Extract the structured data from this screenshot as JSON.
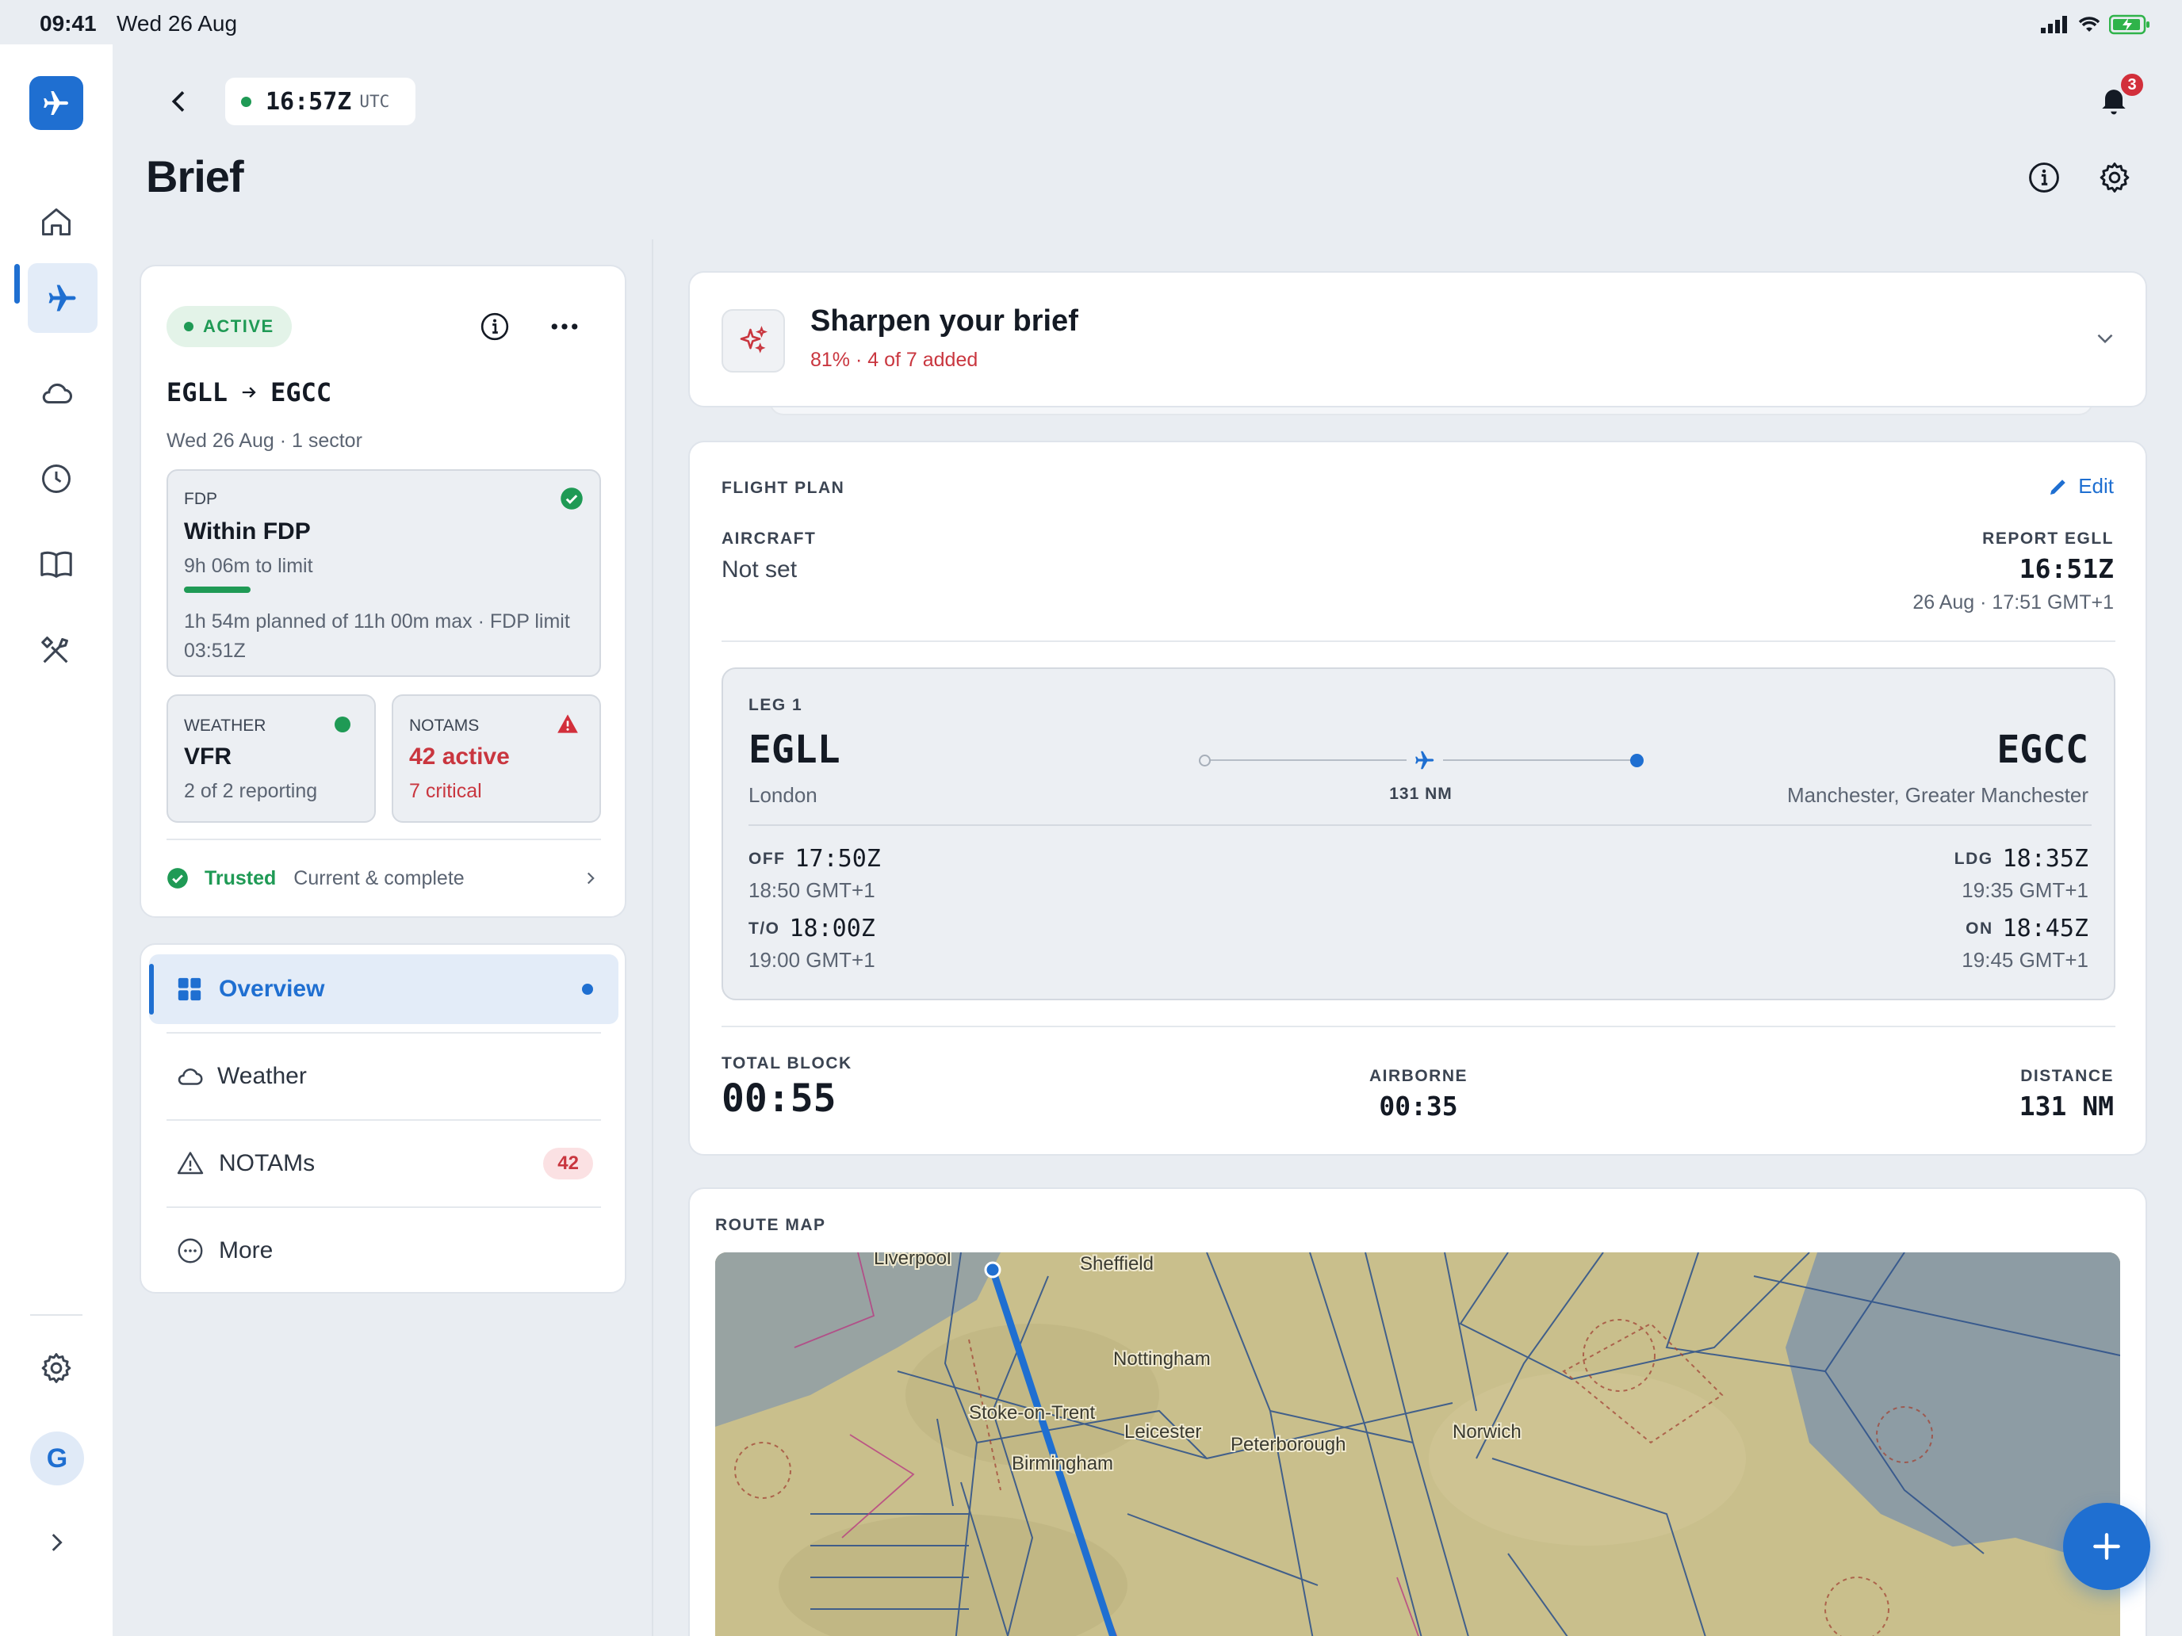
{
  "status_bar": {
    "time": "09:41",
    "date": "Wed 26 Aug"
  },
  "clock": {
    "time": "16:57Z",
    "zone": "UTC"
  },
  "page_title": "Brief",
  "notifications": {
    "count": "3"
  },
  "colors": {
    "accent": "#1f6fd1",
    "green": "#1f9a55",
    "red": "#c9363f",
    "bg": "#e9edf2"
  },
  "nav": {
    "items": [
      "home-icon",
      "flight-icon",
      "weather-icon",
      "history-icon",
      "logbook-icon",
      "tools-icon"
    ],
    "avatar": "G"
  },
  "summary": {
    "status": "ACTIVE",
    "route_from": "EGLL",
    "route_to": "EGCC",
    "subtitle": "Wed 26 Aug · 1 sector",
    "fdp": {
      "label": "FDP",
      "title": "Within FDP",
      "remaining": "9h 06m to limit",
      "progress": 0.165,
      "detail": "1h 54m planned of 11h 00m max · FDP limit 03:51Z"
    },
    "weather": {
      "label": "WEATHER",
      "value": "VFR",
      "detail": "2 of 2 reporting"
    },
    "notams": {
      "label": "NOTAMS",
      "value": "42 active",
      "detail": "7 critical"
    },
    "trust": {
      "label": "Trusted",
      "detail": "Current & complete"
    }
  },
  "sections": [
    {
      "label": "Overview",
      "icon": "grid-icon"
    },
    {
      "label": "Weather",
      "icon": "cloud-icon"
    },
    {
      "label": "NOTAMs",
      "icon": "warning-icon",
      "badge": "42"
    },
    {
      "label": "More",
      "icon": "more-icon"
    }
  ],
  "sharpen": {
    "title": "Sharpen your brief",
    "subtitle": "81% · 4 of 7 added"
  },
  "flight_plan": {
    "heading": "FLIGHT PLAN",
    "edit": "Edit",
    "aircraft_label": "AIRCRAFT",
    "aircraft_value": "Not set",
    "report_label": "REPORT EGLL",
    "report_time": "16:51Z",
    "report_local": "26 Aug · 17:51 GMT+1",
    "leg": {
      "label": "LEG 1",
      "from": "EGLL",
      "from_city": "London",
      "to": "EGCC",
      "to_city": "Manchester, Greater Manchester",
      "distance": "131 NM",
      "off_label": "OFF",
      "off_time": "17:50Z",
      "off_local": "18:50 GMT+1",
      "to_label": "T/O",
      "to_time": "18:00Z",
      "to_local": "19:00 GMT+1",
      "ldg_label": "LDG",
      "ldg_time": "18:35Z",
      "ldg_local": "19:35 GMT+1",
      "on_label": "ON",
      "on_time": "18:45Z",
      "on_local": "19:45 GMT+1"
    },
    "total_block_label": "TOTAL BLOCK",
    "total_block": "00:55",
    "airborne_label": "AIRBORNE",
    "airborne": "00:35",
    "distance_label": "DISTANCE",
    "distance": "131 NM"
  },
  "route_map": {
    "heading": "ROUTE MAP",
    "places": [
      "Liverpool",
      "Sheffield",
      "Stoke-on-Trent",
      "Nottingham",
      "Leicester",
      "Peterborough",
      "Birmingham",
      "Norwich"
    ]
  }
}
